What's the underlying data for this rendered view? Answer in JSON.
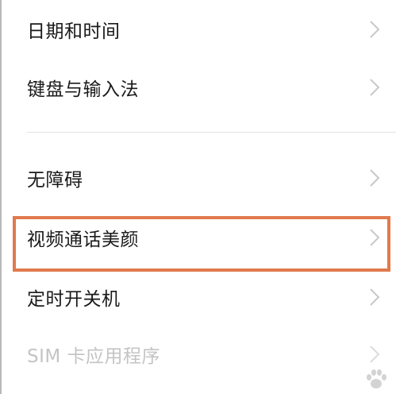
{
  "settings": {
    "items": [
      {
        "label": "日期和时间",
        "enabled": true
      },
      {
        "label": "键盘与输入法",
        "enabled": true
      },
      {
        "label": "无障碍",
        "enabled": true
      },
      {
        "label": "视频通话美颜",
        "enabled": true,
        "highlighted": true
      },
      {
        "label": "定时开关机",
        "enabled": true
      },
      {
        "label": "SIM 卡应用程序",
        "enabled": false
      }
    ]
  },
  "colors": {
    "highlight_border": "#e07a4d",
    "text": "#1a1a1a",
    "disabled_text": "#c4c4c4",
    "chevron": "#c8c8c8"
  },
  "icons": {
    "chevron": "chevron-right-icon"
  }
}
